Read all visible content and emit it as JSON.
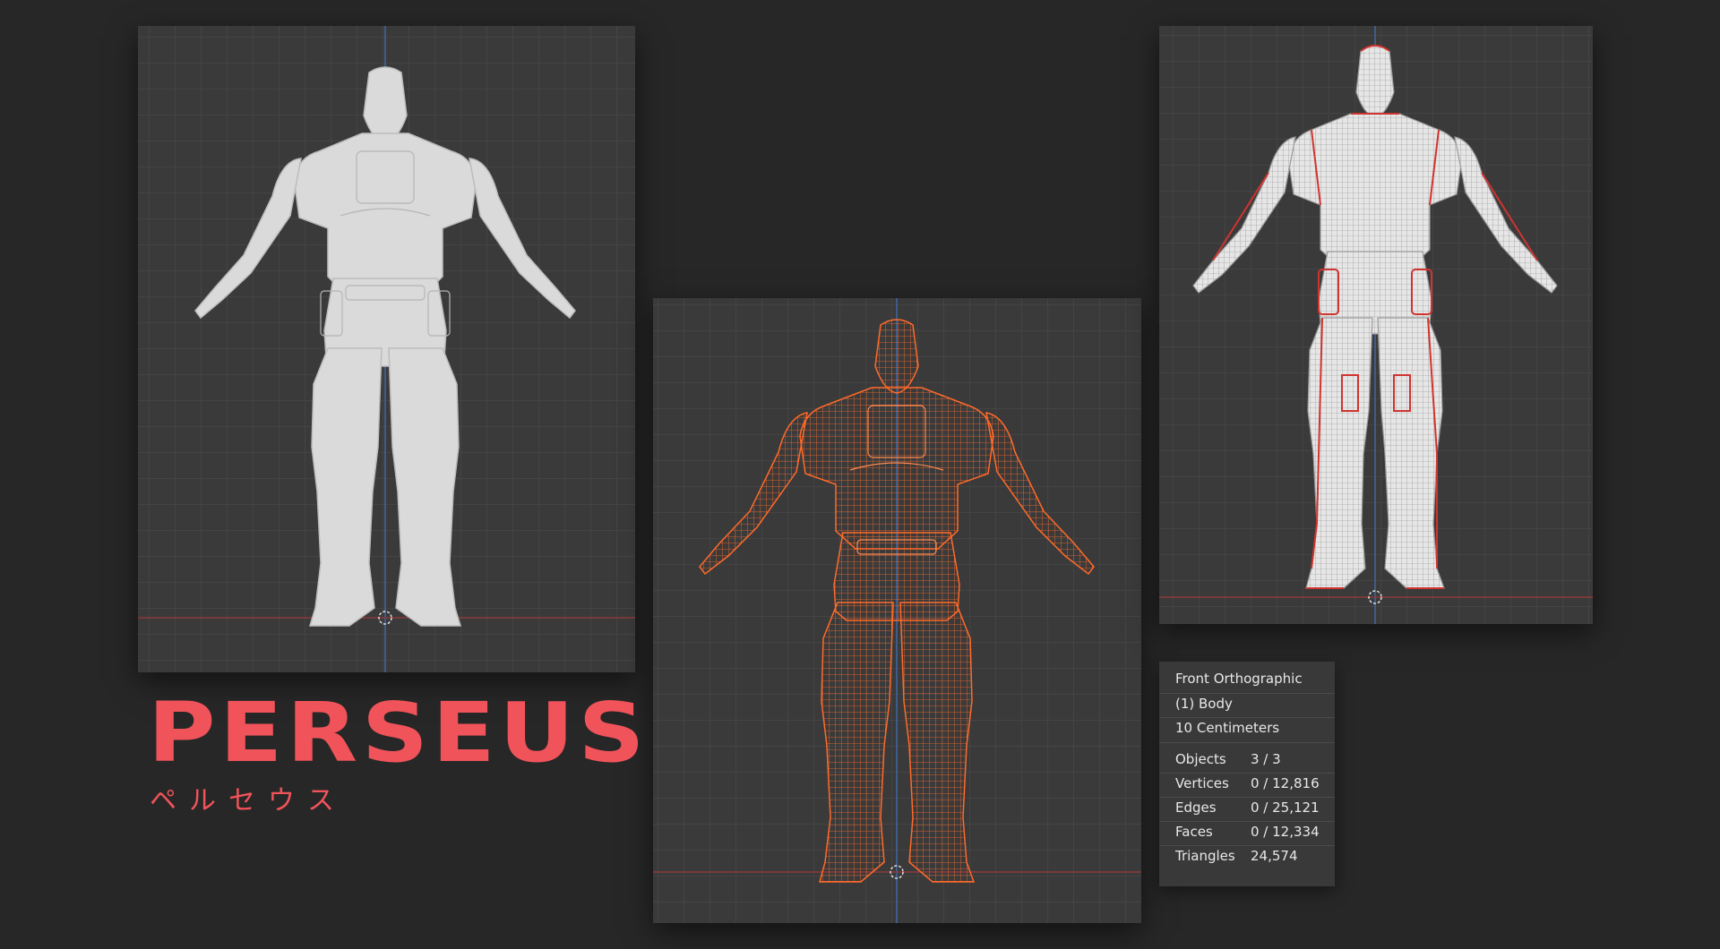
{
  "title": "PERSEUS",
  "subtitle": "ペルセウス",
  "viewports": {
    "left": {
      "shading": "solid"
    },
    "center": {
      "shading": "wireframe"
    },
    "right": {
      "shading": "wireframe-overlay"
    }
  },
  "stats": {
    "view": "Front Orthographic",
    "object": "(1) Body",
    "scale": "10 Centimeters",
    "rows": [
      {
        "label": "Objects",
        "value": "3 / 3"
      },
      {
        "label": "Vertices",
        "value": "0 / 12,816"
      },
      {
        "label": "Edges",
        "value": "0 / 25,121"
      },
      {
        "label": "Faces",
        "value": "0 / 12,334"
      },
      {
        "label": "Triangles",
        "value": "24,574"
      }
    ]
  },
  "colors": {
    "background": "#272727",
    "viewport": "#3a3a3a",
    "accent": "#f0535a",
    "wireframe": "#ff6a2a",
    "solid_model": "#d9d9d9"
  }
}
